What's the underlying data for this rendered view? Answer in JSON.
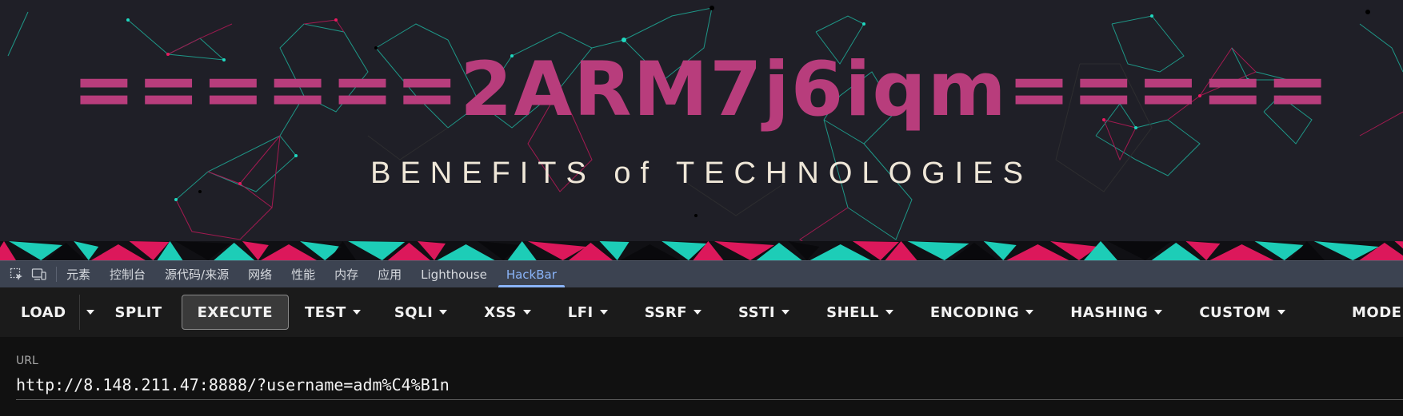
{
  "banner": {
    "title": "======2ARM7j6iqm=====",
    "subtitle": "BENEFITS of TECHNOLOGIES",
    "title_color": "#b83d7c",
    "subtitle_color": "#efe7d8",
    "accent_pink": "#e8195f",
    "accent_teal": "#1fd8c0"
  },
  "devtools": {
    "icons": [
      "inspect-element-icon",
      "device-toolbar-icon"
    ],
    "tabs": [
      {
        "label": "元素"
      },
      {
        "label": "控制台"
      },
      {
        "label": "源代码/来源"
      },
      {
        "label": "网络"
      },
      {
        "label": "性能"
      },
      {
        "label": "内存"
      },
      {
        "label": "应用"
      },
      {
        "label": "Lighthouse"
      },
      {
        "label": "HackBar",
        "active": true
      }
    ],
    "active_color": "#8ab4f8"
  },
  "hackbar": {
    "load": "LOAD",
    "split": "SPLIT",
    "execute": "EXECUTE",
    "test": "TEST",
    "sqli": "SQLI",
    "xss": "XSS",
    "lfi": "LFI",
    "ssrf": "SSRF",
    "ssti": "SSTI",
    "shell": "SHELL",
    "encoding": "ENCODING",
    "hashing": "HASHING",
    "custom": "CUSTOM",
    "mode": "MODE"
  },
  "url": {
    "label": "URL",
    "value": "http://8.148.211.47:8888/?username=adm%C4%B1n"
  }
}
